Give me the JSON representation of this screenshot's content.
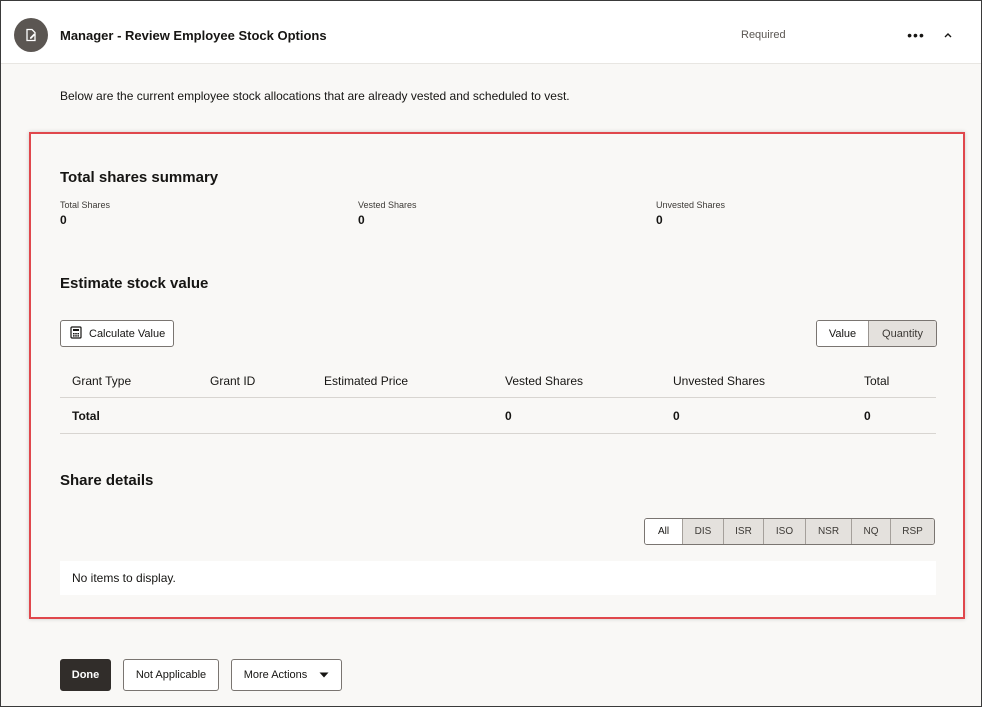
{
  "header": {
    "title": "Manager - Review Employee Stock Options",
    "status": "Required",
    "task_icon": "document-edit-icon",
    "more_icon": "ellipsis-icon",
    "collapse_icon": "chevron-up-icon"
  },
  "intro": "Below are the current employee stock allocations that are already vested and scheduled to vest.",
  "summary": {
    "title": "Total shares summary",
    "metrics": [
      {
        "label": "Total Shares",
        "value": "0"
      },
      {
        "label": "Vested Shares",
        "value": "0"
      },
      {
        "label": "Unvested Shares",
        "value": "0"
      }
    ]
  },
  "estimate": {
    "title": "Estimate stock value",
    "calculate_label": "Calculate Value",
    "calculate_icon": "calculator-icon",
    "toggle": {
      "value_label": "Value",
      "quantity_label": "Quantity",
      "selected": "Value"
    },
    "columns": [
      "Grant Type",
      "Grant ID",
      "Estimated Price",
      "Vested Shares",
      "Unvested Shares",
      "Total"
    ],
    "total_row": {
      "label": "Total",
      "vested": "0",
      "unvested": "0",
      "total": "0"
    }
  },
  "share_details": {
    "title": "Share details",
    "filters": [
      "All",
      "DIS",
      "ISR",
      "ISO",
      "NSR",
      "NQ",
      "RSP"
    ],
    "selected_filter": "All",
    "empty_text": "No items to display."
  },
  "footer": {
    "done_label": "Done",
    "not_applicable_label": "Not Applicable",
    "more_actions_label": "More Actions",
    "more_actions_icon": "caret-down-icon"
  },
  "colors": {
    "highlight_border": "#e0474c",
    "primary_button": "#312d2a",
    "page_background": "#f9f8f6"
  }
}
